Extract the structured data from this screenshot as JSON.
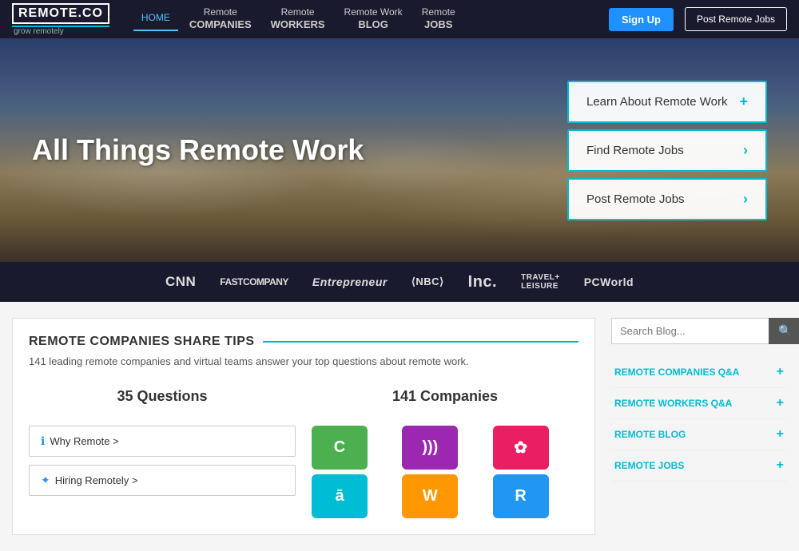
{
  "navbar": {
    "logo": "REMOTE.CO",
    "tagline": "grow remotely",
    "nav_home": "HOME",
    "nav_companies_line1": "Remote",
    "nav_companies_line2": "COMPANIES",
    "nav_workers_line1": "Remote",
    "nav_workers_line2": "WORKERS",
    "nav_blog_line1": "Remote Work",
    "nav_blog_line2": "BLOG",
    "nav_jobs_line1": "Remote",
    "nav_jobs_line2": "JOBS",
    "btn_signup": "Sign Up",
    "btn_post": "Post Remote Jobs"
  },
  "hero": {
    "title": "All Things Remote Work",
    "btn1_label": "Learn About Remote Work",
    "btn1_icon": "+",
    "btn2_label": "Find Remote Jobs",
    "btn2_icon": "›",
    "btn3_label": "Post Remote Jobs",
    "btn3_icon": "›"
  },
  "press": {
    "logos": [
      "CNN",
      "FASTCOMPANY",
      "Entrepreneur",
      "NBC",
      "Inc.",
      "TRAVEL+LEISURE",
      "PCWorld"
    ]
  },
  "main": {
    "section_title": "REMOTE COMPANIES SHARE TIPS",
    "section_subtitle": "141 leading remote companies and virtual teams answer your top questions about remote work.",
    "stat1_label": "35 Questions",
    "stat2_label": "141 Companies",
    "link1_label": "Why Remote >",
    "link2_label": "Hiring Remotely >",
    "company_colors": [
      "#4caf50",
      "#9c27b0",
      "#e91e63",
      "#00bcd4",
      "#ff9800",
      "#2196f3"
    ]
  },
  "sidebar": {
    "search_placeholder": "Search Blog...",
    "menu_items": [
      "REMOTE COMPANIES Q&A",
      "REMOTE WORKERS Q&A",
      "REMOTE BLOG",
      "REMOTE JOBS"
    ]
  }
}
